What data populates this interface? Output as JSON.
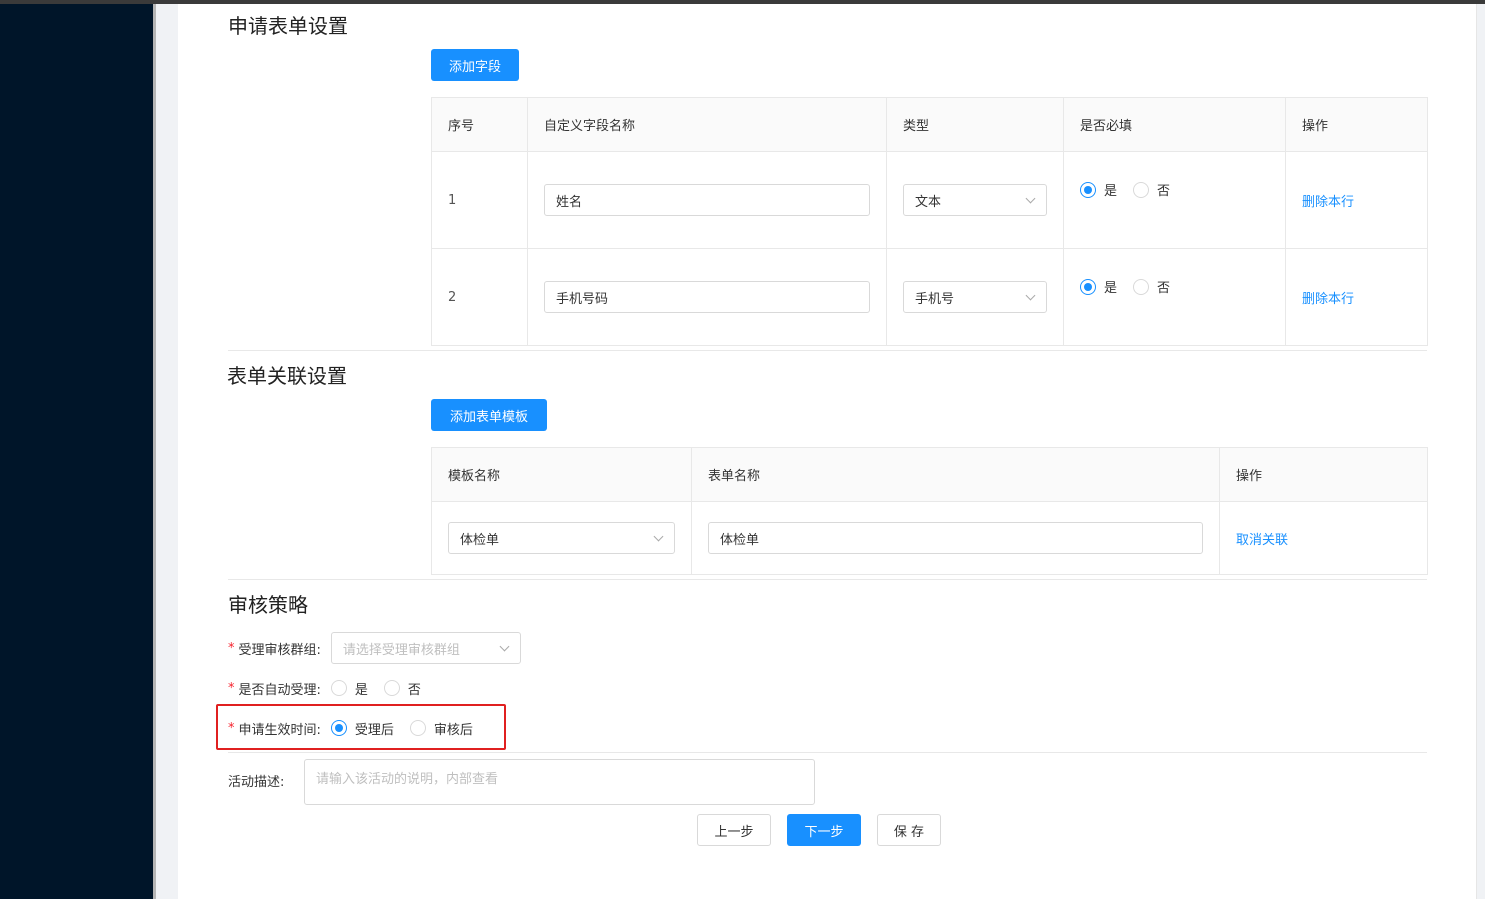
{
  "section1": {
    "title": "申请表单设置",
    "add_button": "添加字段",
    "columns": [
      "序号",
      "自定义字段名称",
      "类型",
      "是否必填",
      "操作"
    ],
    "rows": [
      {
        "index": "1",
        "field_name": "姓名",
        "type": "文本",
        "required_yes": "是",
        "required_no": "否",
        "required": "yes",
        "action": "删除本行"
      },
      {
        "index": "2",
        "field_name": "手机号码",
        "type": "手机号",
        "required_yes": "是",
        "required_no": "否",
        "required": "yes",
        "action": "删除本行"
      }
    ]
  },
  "section2": {
    "title": "表单关联设置",
    "add_button": "添加表单模板",
    "columns": [
      "模板名称",
      "表单名称",
      "操作"
    ],
    "rows": [
      {
        "template": "体检单",
        "form_name": "体检单",
        "action": "取消关联"
      }
    ]
  },
  "section3": {
    "title": "审核策略",
    "group_label": "受理审核群组:",
    "group_placeholder": "请选择受理审核群组",
    "auto_label": "是否自动受理:",
    "auto_yes": "是",
    "auto_no": "否",
    "effective_label": "申请生效时间:",
    "effective_opt1": "受理后",
    "effective_opt2": "审核后",
    "effective_selected": "受理后",
    "desc_label": "活动描述:",
    "desc_placeholder": "请输入该活动的说明，内部查看",
    "required_mark": "*"
  },
  "footer": {
    "prev": "上一步",
    "next": "下一步",
    "save": "保 存"
  },
  "colors": {
    "primary": "#1890ff",
    "sidebar": "#001529",
    "required": "#f5222d",
    "highlight": "#e02020"
  }
}
